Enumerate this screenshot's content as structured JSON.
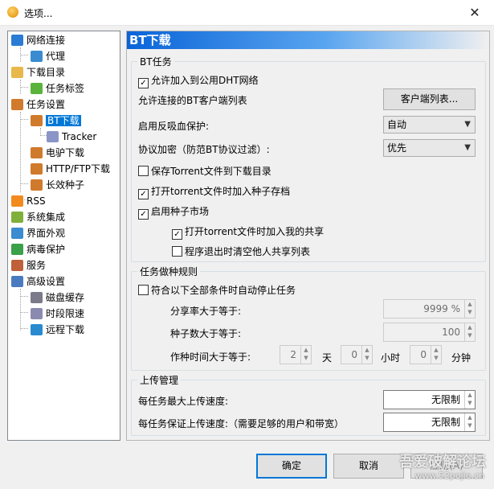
{
  "window": {
    "title": "选项..."
  },
  "tree": [
    {
      "label": "网络连接",
      "icon": "globe-icon",
      "color": "#2a7bd4"
    },
    {
      "label": "代理",
      "icon": "proxy-icon",
      "color": "#3a8bd0"
    },
    {
      "label": "下载目录",
      "icon": "folder-icon",
      "color": "#e8b84a"
    },
    {
      "label": "任务标签",
      "icon": "tag-icon",
      "color": "#5ab33c"
    },
    {
      "label": "任务设置",
      "icon": "clipboard-icon",
      "color": "#d07a2c"
    },
    {
      "label": "BT下载",
      "icon": "clipboard-icon",
      "color": "#d07a2c"
    },
    {
      "label": "Tracker",
      "icon": "cube-icon",
      "color": "#8a96c8"
    },
    {
      "label": "电驴下载",
      "icon": "clipboard-icon",
      "color": "#d07a2c"
    },
    {
      "label": "HTTP/FTP下载",
      "icon": "clipboard-icon",
      "color": "#d07a2c"
    },
    {
      "label": "长效种子",
      "icon": "clipboard-icon",
      "color": "#d07a2c"
    },
    {
      "label": "RSS",
      "icon": "rss-icon",
      "color": "#f28a1e"
    },
    {
      "label": "系统集成",
      "icon": "integration-icon",
      "color": "#7fb03a"
    },
    {
      "label": "界面外观",
      "icon": "appearance-icon",
      "color": "#3a8bd0"
    },
    {
      "label": "病毒保护",
      "icon": "shield-icon",
      "color": "#3aa04a"
    },
    {
      "label": "服务",
      "icon": "users-icon",
      "color": "#c0603a"
    },
    {
      "label": "高级设置",
      "icon": "advanced-icon",
      "color": "#4a7bc0"
    },
    {
      "label": "磁盘缓存",
      "icon": "disk-icon",
      "color": "#7a7a8a"
    },
    {
      "label": "时段限速",
      "icon": "key-icon",
      "color": "#8a8ab0"
    },
    {
      "label": "远程下载",
      "icon": "remote-icon",
      "color": "#2a8ad0"
    }
  ],
  "panel": {
    "header": "BT下载",
    "bt_task": {
      "title": "BT任务",
      "allow_dht": "允许加入到公用DHT网络",
      "client_list_label": "允许连接的BT客户端列表",
      "client_list_button": "客户端列表...",
      "anti_leech_label": "启用反吸血保护:",
      "anti_leech_value": "自动",
      "encryption_label": "协议加密（防范BT协议过滤）:",
      "encryption_value": "优先",
      "save_torrent": "保存Torrent文件到下载目录",
      "add_archive": "打开torrent文件时加入种子存档",
      "seed_market": "启用种子市场",
      "add_share": "打开torrent文件时加入我的共享",
      "clear_share": "程序退出时清空他人共享列表"
    },
    "seeding": {
      "title": "任务做种规则",
      "auto_stop": "符合以下全部条件时自动停止任务",
      "ratio_label": "分享率大于等于:",
      "ratio_value": "9999 %",
      "seeds_label": "种子数大于等于:",
      "seeds_value": "100",
      "time_label": "作种时间大于等于:",
      "days_value": "2",
      "days_unit": "天",
      "hours_value": "0",
      "hours_unit": "小时",
      "minutes_value": "0",
      "minutes_unit": "分钟"
    },
    "upload": {
      "title": "上传管理",
      "max_label": "每任务最大上传速度:",
      "max_value": "无限制",
      "guarantee_label": "每任务保证上传速度:（需要足够的用户和带宽）",
      "guarantee_value": "无限制"
    }
  },
  "buttons": {
    "ok": "确定",
    "cancel": "取消",
    "apply": "应用(A)"
  },
  "watermark": {
    "line1": "吾爱破解论坛",
    "line2": "www.52pojie.cn"
  }
}
